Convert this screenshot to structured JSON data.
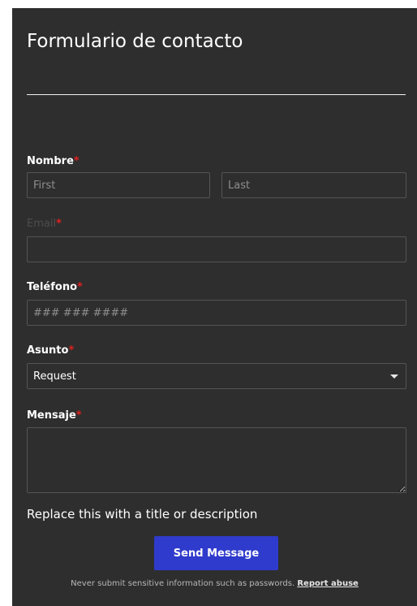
{
  "form": {
    "title": "Formulario de contacto",
    "required_mark": "*",
    "name": {
      "label": "Nombre",
      "first_placeholder": "First",
      "last_placeholder": "Last"
    },
    "email": {
      "label": "Email",
      "value": ""
    },
    "phone": {
      "label": "Teléfono",
      "placeholder": "### ### ####"
    },
    "subject": {
      "label": "Asunto",
      "selected": "Request"
    },
    "message": {
      "label": "Mensaje",
      "value": ""
    },
    "description": "Replace this with a title or description",
    "submit_label": "Send Message",
    "footer": {
      "note": "Never submit sensitive information such as passwords.",
      "report_link": "Report abuse"
    }
  },
  "colors": {
    "panel_background": "#2e2e2e",
    "button": "#2f3bcc",
    "required": "#e02020"
  },
  "icons": {
    "dropdown": "caret-down-icon"
  }
}
